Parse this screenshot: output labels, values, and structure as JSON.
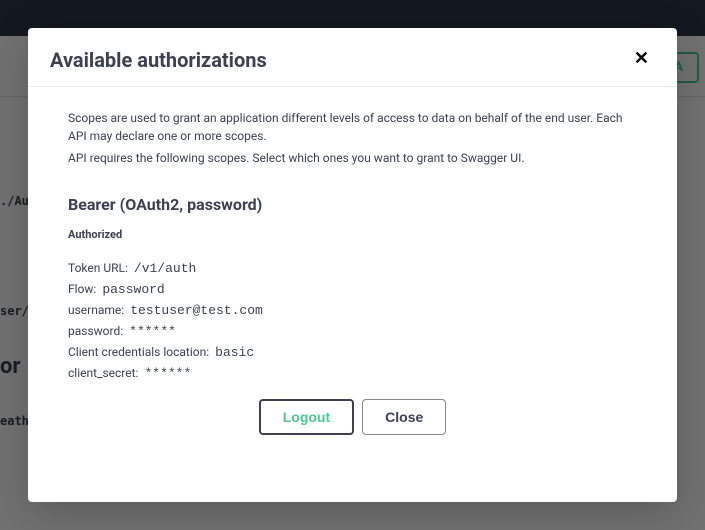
{
  "background": {
    "authorize_label": "A",
    "path1": "./Au",
    "path2": "ser/",
    "heading": "or",
    "path3": "eath"
  },
  "modal": {
    "title": "Available authorizations",
    "desc1": "Scopes are used to grant an application different levels of access to data on behalf of the end user. Each API may declare one or more scopes.",
    "desc2": "API requires the following scopes. Select which ones you want to grant to Swagger UI.",
    "scheme_title": "Bearer (OAuth2, password)",
    "status": "Authorized",
    "fields": {
      "token_url_label": "Token URL:",
      "token_url_value": "/v1/auth",
      "flow_label": "Flow:",
      "flow_value": "password",
      "username_label": "username:",
      "username_value": "testuser@test.com",
      "password_label": "password:",
      "password_value": "******",
      "cred_loc_label": "Client credentials location:",
      "cred_loc_value": "basic",
      "client_secret_label": "client_secret:",
      "client_secret_value": "******"
    },
    "buttons": {
      "logout": "Logout",
      "close": "Close"
    }
  }
}
